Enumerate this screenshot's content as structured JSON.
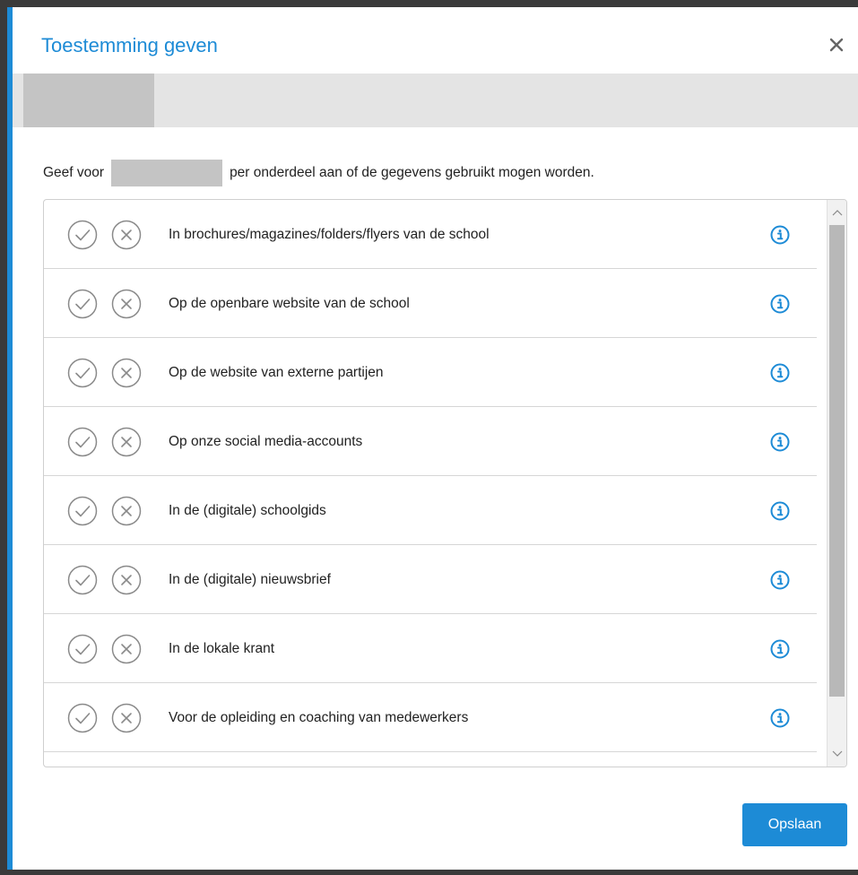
{
  "dialog": {
    "title": "Toestemming geven",
    "intro_before": "Geef voor",
    "intro_after": "per onderdeel aan of de gegevens gebruikt mogen worden.",
    "save_label": "Opslaan"
  },
  "items": [
    {
      "label": "In brochures/magazines/folders/flyers van de school"
    },
    {
      "label": "Op de openbare website van de school"
    },
    {
      "label": "Op de website van externe partijen"
    },
    {
      "label": "Op onze social media-accounts"
    },
    {
      "label": "In de (digitale) schoolgids"
    },
    {
      "label": "In de (digitale) nieuwsbrief"
    },
    {
      "label": "In de lokale krant"
    },
    {
      "label": "Voor de opleiding en coaching van medewerkers"
    }
  ],
  "icons": {
    "accept": "check-circle-icon",
    "reject": "x-circle-icon",
    "info": "info-icon",
    "close": "close-icon"
  },
  "colors": {
    "accent": "#1d8bd6",
    "icon_grey": "#8a8a8a"
  }
}
